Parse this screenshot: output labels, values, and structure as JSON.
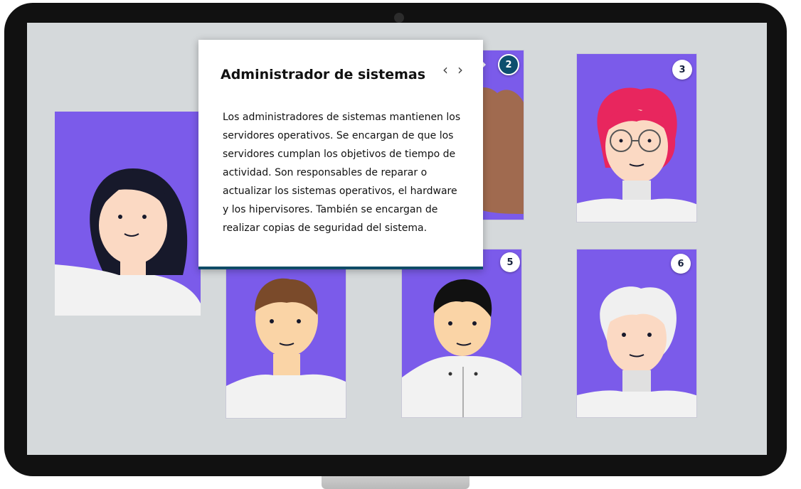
{
  "popup": {
    "title": "Administrador de sistemas",
    "body": "Los administradores de sistemas mantienen los servidores operativos. Se encargan de que los servidores cumplan los objetivos de tiempo de actividad. Son responsables de reparar o actualizar los sistemas operativos, el hardware y los hipervisores. También se encargan de realizar copias de seguridad del sistema.",
    "prev_icon": "chevron-left-icon",
    "next_icon": "chevron-right-icon",
    "prev_glyph": "‹",
    "next_glyph": "›"
  },
  "cards": [
    {
      "number": "2",
      "active": true
    },
    {
      "number": "3",
      "active": false
    },
    {
      "number": "5",
      "active": false
    },
    {
      "number": "6",
      "active": false
    }
  ],
  "colors": {
    "card_bg": "#7b5bea",
    "screen_bg": "#d5d9db",
    "active_badge": "#0d4f6e",
    "popup_border": "#0f4b66"
  }
}
